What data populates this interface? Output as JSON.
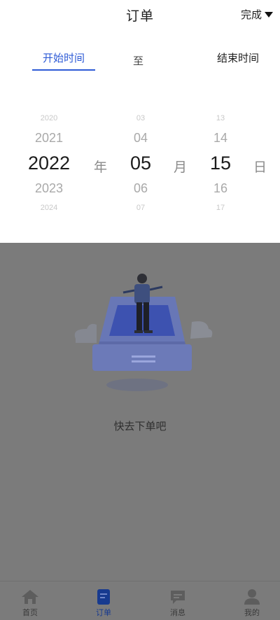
{
  "header": {
    "title": "订单",
    "done_label": "完成"
  },
  "range": {
    "start_label": "开始时间",
    "separator": "至",
    "end_label": "结束时间",
    "active": "start"
  },
  "picker": {
    "year": {
      "options": [
        "2020",
        "2021",
        "2022",
        "2023",
        "2024"
      ],
      "selected": "2022",
      "unit": "年"
    },
    "month": {
      "options": [
        "03",
        "04",
        "05",
        "06",
        "07"
      ],
      "selected": "05",
      "unit": "月"
    },
    "day": {
      "options": [
        "13",
        "14",
        "15",
        "16",
        "17"
      ],
      "selected": "15",
      "unit": "日"
    }
  },
  "empty_state": {
    "text": "快去下单吧"
  },
  "nav": {
    "items": [
      {
        "label": "首页",
        "icon": "home-icon"
      },
      {
        "label": "订单",
        "icon": "orders-icon",
        "active": true
      },
      {
        "label": "消息",
        "icon": "message-icon"
      },
      {
        "label": "我的",
        "icon": "person-icon"
      }
    ]
  },
  "colors": {
    "accent": "#2e5bd6",
    "overlay": "#7b7b7b",
    "nav_active": "#173a8f"
  }
}
